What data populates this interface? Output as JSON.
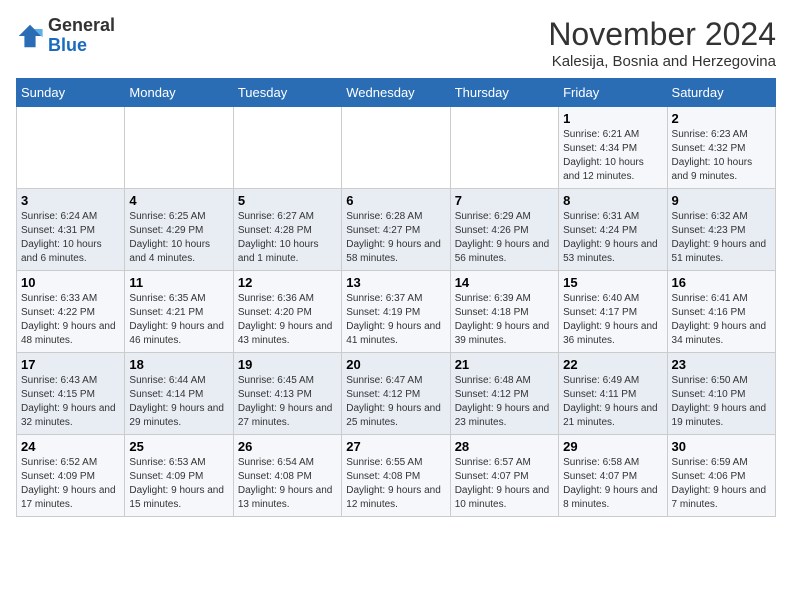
{
  "logo": {
    "general": "General",
    "blue": "Blue"
  },
  "title": "November 2024",
  "subtitle": "Kalesija, Bosnia and Herzegovina",
  "days_of_week": [
    "Sunday",
    "Monday",
    "Tuesday",
    "Wednesday",
    "Thursday",
    "Friday",
    "Saturday"
  ],
  "weeks": [
    [
      {
        "day": "",
        "info": ""
      },
      {
        "day": "",
        "info": ""
      },
      {
        "day": "",
        "info": ""
      },
      {
        "day": "",
        "info": ""
      },
      {
        "day": "",
        "info": ""
      },
      {
        "day": "1",
        "info": "Sunrise: 6:21 AM\nSunset: 4:34 PM\nDaylight: 10 hours and 12 minutes."
      },
      {
        "day": "2",
        "info": "Sunrise: 6:23 AM\nSunset: 4:32 PM\nDaylight: 10 hours and 9 minutes."
      }
    ],
    [
      {
        "day": "3",
        "info": "Sunrise: 6:24 AM\nSunset: 4:31 PM\nDaylight: 10 hours and 6 minutes."
      },
      {
        "day": "4",
        "info": "Sunrise: 6:25 AM\nSunset: 4:29 PM\nDaylight: 10 hours and 4 minutes."
      },
      {
        "day": "5",
        "info": "Sunrise: 6:27 AM\nSunset: 4:28 PM\nDaylight: 10 hours and 1 minute."
      },
      {
        "day": "6",
        "info": "Sunrise: 6:28 AM\nSunset: 4:27 PM\nDaylight: 9 hours and 58 minutes."
      },
      {
        "day": "7",
        "info": "Sunrise: 6:29 AM\nSunset: 4:26 PM\nDaylight: 9 hours and 56 minutes."
      },
      {
        "day": "8",
        "info": "Sunrise: 6:31 AM\nSunset: 4:24 PM\nDaylight: 9 hours and 53 minutes."
      },
      {
        "day": "9",
        "info": "Sunrise: 6:32 AM\nSunset: 4:23 PM\nDaylight: 9 hours and 51 minutes."
      }
    ],
    [
      {
        "day": "10",
        "info": "Sunrise: 6:33 AM\nSunset: 4:22 PM\nDaylight: 9 hours and 48 minutes."
      },
      {
        "day": "11",
        "info": "Sunrise: 6:35 AM\nSunset: 4:21 PM\nDaylight: 9 hours and 46 minutes."
      },
      {
        "day": "12",
        "info": "Sunrise: 6:36 AM\nSunset: 4:20 PM\nDaylight: 9 hours and 43 minutes."
      },
      {
        "day": "13",
        "info": "Sunrise: 6:37 AM\nSunset: 4:19 PM\nDaylight: 9 hours and 41 minutes."
      },
      {
        "day": "14",
        "info": "Sunrise: 6:39 AM\nSunset: 4:18 PM\nDaylight: 9 hours and 39 minutes."
      },
      {
        "day": "15",
        "info": "Sunrise: 6:40 AM\nSunset: 4:17 PM\nDaylight: 9 hours and 36 minutes."
      },
      {
        "day": "16",
        "info": "Sunrise: 6:41 AM\nSunset: 4:16 PM\nDaylight: 9 hours and 34 minutes."
      }
    ],
    [
      {
        "day": "17",
        "info": "Sunrise: 6:43 AM\nSunset: 4:15 PM\nDaylight: 9 hours and 32 minutes."
      },
      {
        "day": "18",
        "info": "Sunrise: 6:44 AM\nSunset: 4:14 PM\nDaylight: 9 hours and 29 minutes."
      },
      {
        "day": "19",
        "info": "Sunrise: 6:45 AM\nSunset: 4:13 PM\nDaylight: 9 hours and 27 minutes."
      },
      {
        "day": "20",
        "info": "Sunrise: 6:47 AM\nSunset: 4:12 PM\nDaylight: 9 hours and 25 minutes."
      },
      {
        "day": "21",
        "info": "Sunrise: 6:48 AM\nSunset: 4:12 PM\nDaylight: 9 hours and 23 minutes."
      },
      {
        "day": "22",
        "info": "Sunrise: 6:49 AM\nSunset: 4:11 PM\nDaylight: 9 hours and 21 minutes."
      },
      {
        "day": "23",
        "info": "Sunrise: 6:50 AM\nSunset: 4:10 PM\nDaylight: 9 hours and 19 minutes."
      }
    ],
    [
      {
        "day": "24",
        "info": "Sunrise: 6:52 AM\nSunset: 4:09 PM\nDaylight: 9 hours and 17 minutes."
      },
      {
        "day": "25",
        "info": "Sunrise: 6:53 AM\nSunset: 4:09 PM\nDaylight: 9 hours and 15 minutes."
      },
      {
        "day": "26",
        "info": "Sunrise: 6:54 AM\nSunset: 4:08 PM\nDaylight: 9 hours and 13 minutes."
      },
      {
        "day": "27",
        "info": "Sunrise: 6:55 AM\nSunset: 4:08 PM\nDaylight: 9 hours and 12 minutes."
      },
      {
        "day": "28",
        "info": "Sunrise: 6:57 AM\nSunset: 4:07 PM\nDaylight: 9 hours and 10 minutes."
      },
      {
        "day": "29",
        "info": "Sunrise: 6:58 AM\nSunset: 4:07 PM\nDaylight: 9 hours and 8 minutes."
      },
      {
        "day": "30",
        "info": "Sunrise: 6:59 AM\nSunset: 4:06 PM\nDaylight: 9 hours and 7 minutes."
      }
    ]
  ]
}
